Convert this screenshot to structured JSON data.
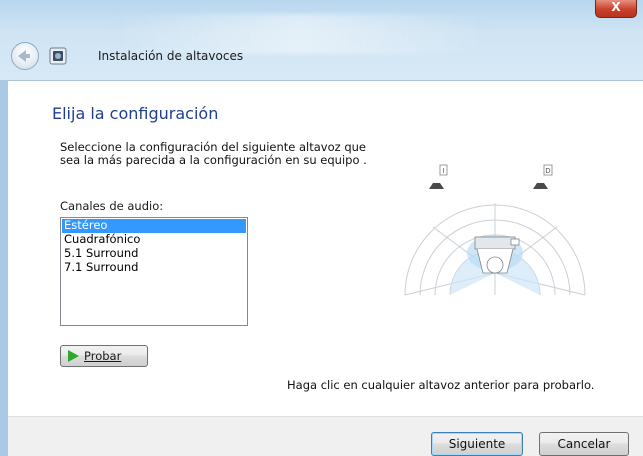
{
  "window": {
    "title": "Instalación de altavoces",
    "close_label": "X"
  },
  "page": {
    "heading": "Elija la configuración",
    "description": "Seleccione la configuración del siguiente altavoz que sea la más parecida a la configuración en su equipo .",
    "channels_label": "Canales de audio:",
    "channels": [
      {
        "label": "Estéreo",
        "selected": true
      },
      {
        "label": "Cuadrafónico",
        "selected": false
      },
      {
        "label": "5.1 Surround",
        "selected": false
      },
      {
        "label": "7.1 Surround",
        "selected": false
      }
    ],
    "test_button_label": "Probar",
    "hint": "Haga clic en cualquier altavoz anterior para probarlo.",
    "speaker_labels": {
      "left": "I",
      "right": "D"
    }
  },
  "footer": {
    "next_label": "Siguiente",
    "cancel_label": "Cancelar"
  },
  "colors": {
    "selection": "#3399ff",
    "heading": "#1e3f8f",
    "close": "#c8412b",
    "play": "#2ea82a"
  }
}
